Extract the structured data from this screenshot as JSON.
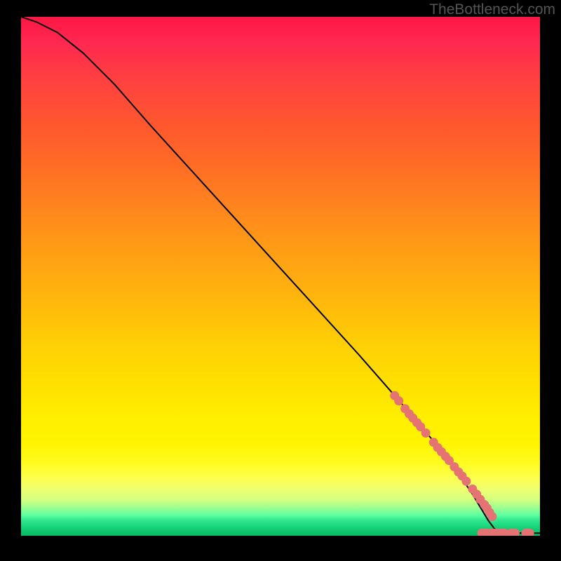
{
  "watermark": "TheBottleneck.com",
  "chart_data": {
    "type": "line",
    "title": "",
    "xlabel": "",
    "ylabel": "",
    "xlim": [
      0,
      100
    ],
    "ylim": [
      0,
      100
    ],
    "curve": [
      {
        "x": 0,
        "y": 100
      },
      {
        "x": 3,
        "y": 99
      },
      {
        "x": 7,
        "y": 97
      },
      {
        "x": 12,
        "y": 93
      },
      {
        "x": 18,
        "y": 87
      },
      {
        "x": 25,
        "y": 79
      },
      {
        "x": 35,
        "y": 68
      },
      {
        "x": 45,
        "y": 57
      },
      {
        "x": 55,
        "y": 46
      },
      {
        "x": 65,
        "y": 35
      },
      {
        "x": 72,
        "y": 27
      },
      {
        "x": 78,
        "y": 20
      },
      {
        "x": 83,
        "y": 14
      },
      {
        "x": 87,
        "y": 8
      },
      {
        "x": 90,
        "y": 3
      },
      {
        "x": 91.5,
        "y": 1
      },
      {
        "x": 93,
        "y": 0.5
      },
      {
        "x": 95,
        "y": 0.5
      },
      {
        "x": 98,
        "y": 0.5
      },
      {
        "x": 100,
        "y": 0.5
      }
    ],
    "highlighted_points": [
      {
        "x": 72,
        "y": 27
      },
      {
        "x": 72.8,
        "y": 26
      },
      {
        "x": 74,
        "y": 24.5
      },
      {
        "x": 74.8,
        "y": 23.5
      },
      {
        "x": 75.5,
        "y": 22.7
      },
      {
        "x": 76.3,
        "y": 21.8
      },
      {
        "x": 77,
        "y": 21
      },
      {
        "x": 78,
        "y": 19.8
      },
      {
        "x": 79.5,
        "y": 18
      },
      {
        "x": 80.3,
        "y": 17
      },
      {
        "x": 81,
        "y": 16.2
      },
      {
        "x": 81.8,
        "y": 15.3
      },
      {
        "x": 82.5,
        "y": 14.5
      },
      {
        "x": 83.5,
        "y": 13.3
      },
      {
        "x": 84.3,
        "y": 12.3
      },
      {
        "x": 85,
        "y": 11.5
      },
      {
        "x": 85.8,
        "y": 10.5
      },
      {
        "x": 87,
        "y": 9
      },
      {
        "x": 87.8,
        "y": 8
      },
      {
        "x": 88.5,
        "y": 7
      },
      {
        "x": 89.3,
        "y": 6
      },
      {
        "x": 89.8,
        "y": 5.3
      },
      {
        "x": 90.3,
        "y": 4.5
      },
      {
        "x": 90.8,
        "y": 3.7
      },
      {
        "x": 88.8,
        "y": 0.5
      },
      {
        "x": 89.5,
        "y": 0.5
      },
      {
        "x": 90.2,
        "y": 0.5
      },
      {
        "x": 91,
        "y": 0.5
      },
      {
        "x": 91.7,
        "y": 0.5
      },
      {
        "x": 92.5,
        "y": 0.5
      },
      {
        "x": 93.2,
        "y": 0.5
      },
      {
        "x": 94.5,
        "y": 0.5
      },
      {
        "x": 95.2,
        "y": 0.5
      },
      {
        "x": 97.3,
        "y": 0.5
      },
      {
        "x": 98,
        "y": 0.5
      }
    ]
  }
}
